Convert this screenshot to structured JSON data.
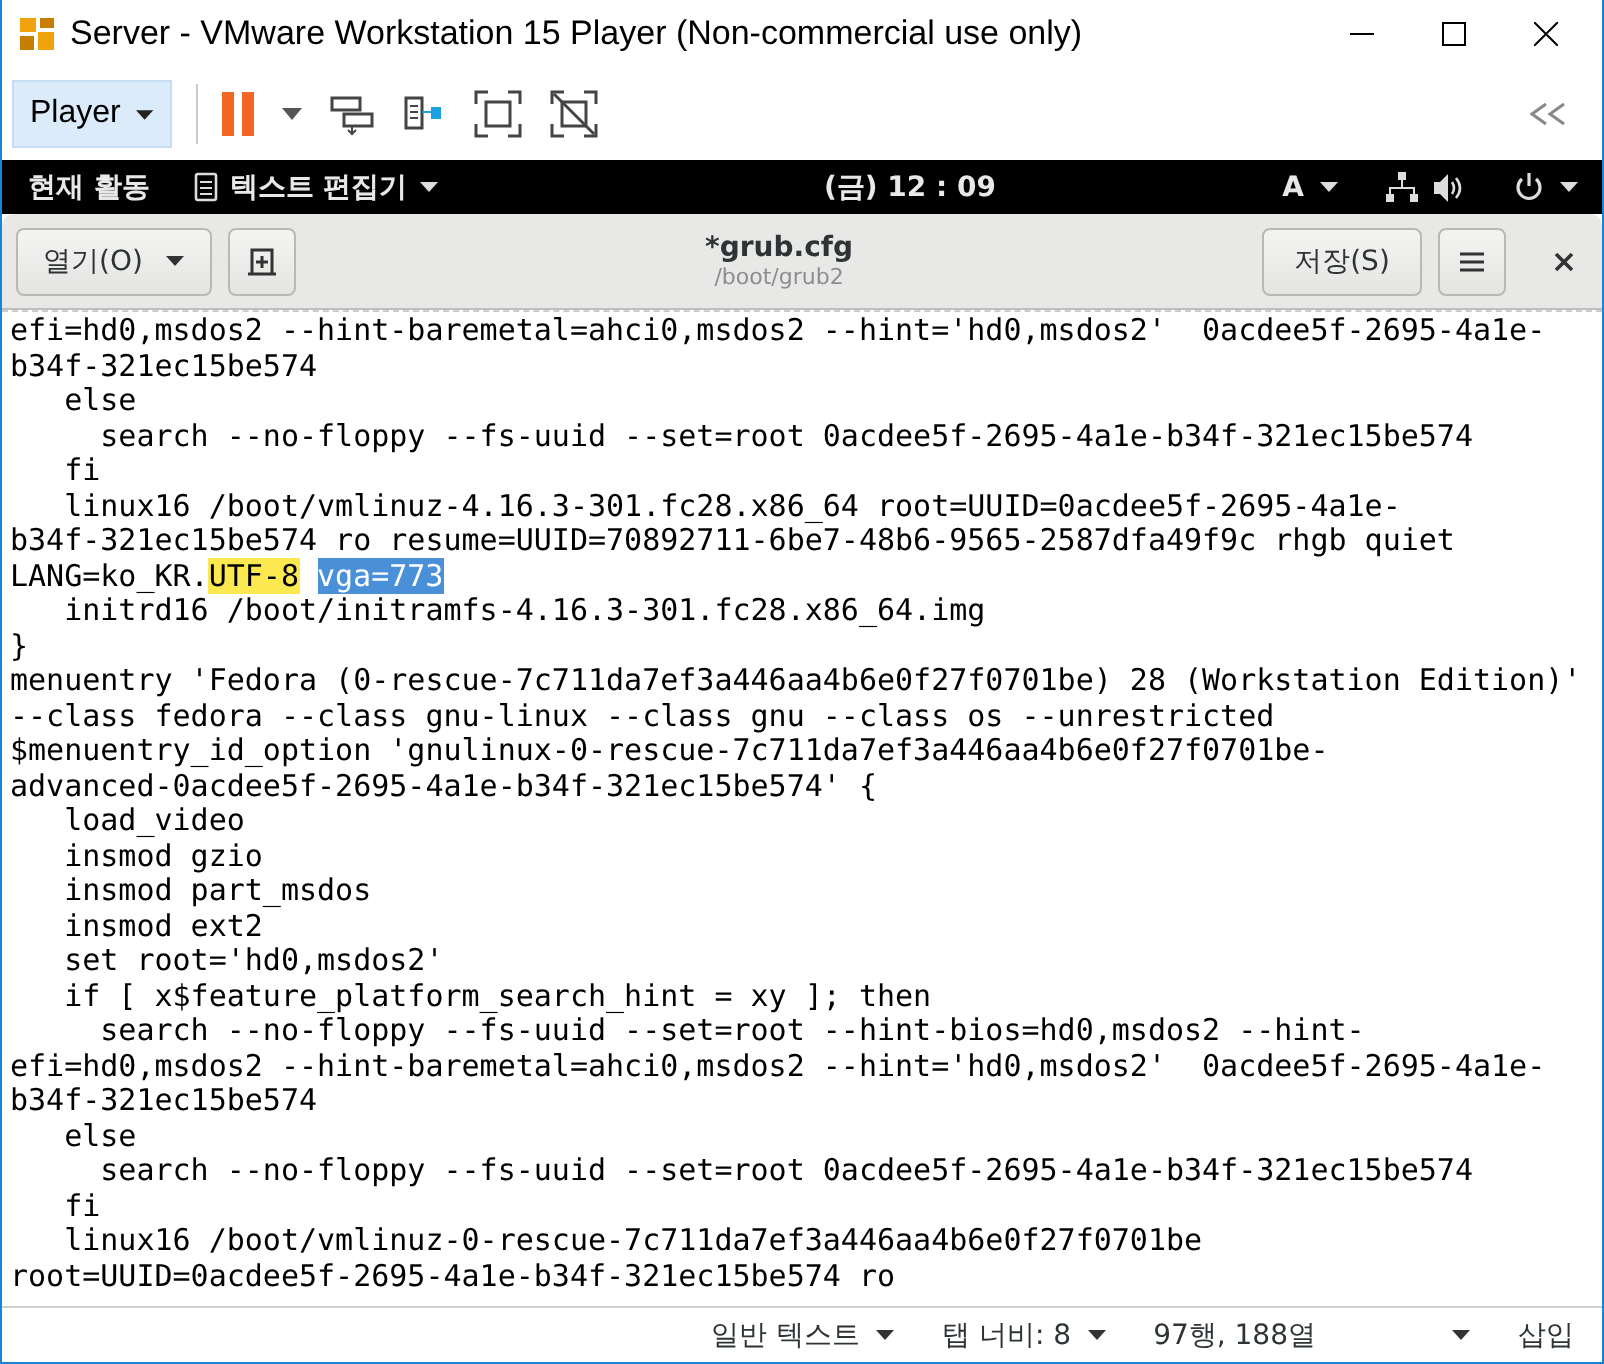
{
  "window": {
    "title": "Server - VMware Workstation 15 Player (Non-commercial use only)"
  },
  "vm_toolbar": {
    "player_menu": "Player"
  },
  "top_bar": {
    "activities": "현재 활동",
    "app_menu": "텍스트 편집기",
    "clock": "(금) 12 : 09",
    "input_method": "A"
  },
  "header_bar": {
    "open_button": "열기(O)",
    "title": "*grub.cfg",
    "subtitle": "/boot/grub2",
    "save_button": "저장(S)"
  },
  "editor": {
    "lines": [
      [
        {
          "text": "efi=hd0,msdos2 --hint-baremetal=ahci0,msdos2 --hint='hd0,msdos2'  0acdee5f-2695-4a1e-"
        }
      ],
      [
        {
          "text": "b34f-321ec15be574"
        }
      ],
      [
        {
          "text": "   else"
        }
      ],
      [
        {
          "text": "     search --no-floppy --fs-uuid --set=root 0acdee5f-2695-4a1e-b34f-321ec15be574"
        }
      ],
      [
        {
          "text": "   fi"
        }
      ],
      [
        {
          "text": "   linux16 /boot/vmlinuz-4.16.3-301.fc28.x86_64 root=UUID=0acdee5f-2695-4a1e-"
        }
      ],
      [
        {
          "text": "b34f-321ec15be574 ro resume=UUID=70892711-6be7-48b6-9565-2587dfa49f9c rhgb quiet"
        }
      ],
      [
        {
          "text": "LANG=ko_KR."
        },
        {
          "text": "UTF-8",
          "kind": "match"
        },
        {
          "text": "vga=773",
          "kind": "selection"
        }
      ],
      [
        {
          "text": "   initrd16 /boot/initramfs-4.16.3-301.fc28.x86_64.img"
        }
      ],
      [
        {
          "text": "}"
        }
      ],
      [
        {
          "text": "menuentry 'Fedora (0-rescue-7c711da7ef3a446aa4b6e0f27f0701be) 28 (Workstation Edition)'"
        }
      ],
      [
        {
          "text": "--class fedora --class gnu-linux --class gnu --class os --unrestricted"
        }
      ],
      [
        {
          "text": "$menuentry_id_option 'gnulinux-0-rescue-7c711da7ef3a446aa4b6e0f27f0701be-"
        }
      ],
      [
        {
          "text": "advanced-0acdee5f-2695-4a1e-b34f-321ec15be574' {"
        }
      ],
      [
        {
          "text": "   load_video"
        }
      ],
      [
        {
          "text": "   insmod gzio"
        }
      ],
      [
        {
          "text": "   insmod part_msdos"
        }
      ],
      [
        {
          "text": "   insmod ext2"
        }
      ],
      [
        {
          "text": "   set root='hd0,msdos2'"
        }
      ],
      [
        {
          "text": "   if [ x$feature_platform_search_hint = xy ]; then"
        }
      ],
      [
        {
          "text": "     search --no-floppy --fs-uuid --set=root --hint-bios=hd0,msdos2 --hint-"
        }
      ],
      [
        {
          "text": "efi=hd0,msdos2 --hint-baremetal=ahci0,msdos2 --hint='hd0,msdos2'  0acdee5f-2695-4a1e-"
        }
      ],
      [
        {
          "text": "b34f-321ec15be574"
        }
      ],
      [
        {
          "text": "   else"
        }
      ],
      [
        {
          "text": "     search --no-floppy --fs-uuid --set=root 0acdee5f-2695-4a1e-b34f-321ec15be574"
        }
      ],
      [
        {
          "text": "   fi"
        }
      ],
      [
        {
          "text": "   linux16 /boot/vmlinuz-0-rescue-7c711da7ef3a446aa4b6e0f27f0701be"
        }
      ],
      [
        {
          "text": "root=UUID=0acdee5f-2695-4a1e-b34f-321ec15be574 ro"
        }
      ]
    ]
  },
  "status_bar": {
    "language": "일반 텍스트",
    "tab_width": "탭 너비: 8",
    "position": "97행, 188열",
    "mode": "삽입"
  }
}
